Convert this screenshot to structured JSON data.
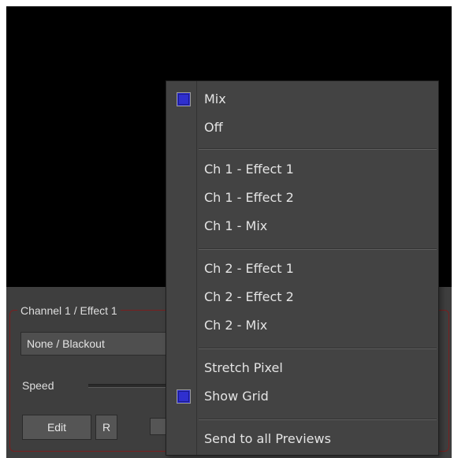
{
  "channel_panel": {
    "group_title": "Channel 1 / Effect 1",
    "effect_select_value": "None / Blackout",
    "speed_label": "Speed",
    "edit_label": "Edit",
    "r_label": "R"
  },
  "context_menu": {
    "items": [
      {
        "label": "Mix",
        "checked": true
      },
      {
        "label": "Off",
        "checked": false
      },
      {
        "label": "Ch 1 - Effect 1",
        "checked": false
      },
      {
        "label": "Ch 1 - Effect 2",
        "checked": false
      },
      {
        "label": "Ch 1 - Mix",
        "checked": false
      },
      {
        "label": "Ch 2 - Effect 1",
        "checked": false
      },
      {
        "label": "Ch 2 - Effect 2",
        "checked": false
      },
      {
        "label": "Ch 2 - Mix",
        "checked": false
      },
      {
        "label": "Stretch Pixel",
        "checked": false
      },
      {
        "label": "Show Grid",
        "checked": true
      },
      {
        "label": "Send to all Previews",
        "checked": false
      }
    ]
  },
  "colors": {
    "preview_background": "#000000",
    "panel_background": "#3e3e3e",
    "group_border": "#7a1f1f",
    "menu_background": "#434343",
    "check_fill": "#2f2fcf"
  }
}
